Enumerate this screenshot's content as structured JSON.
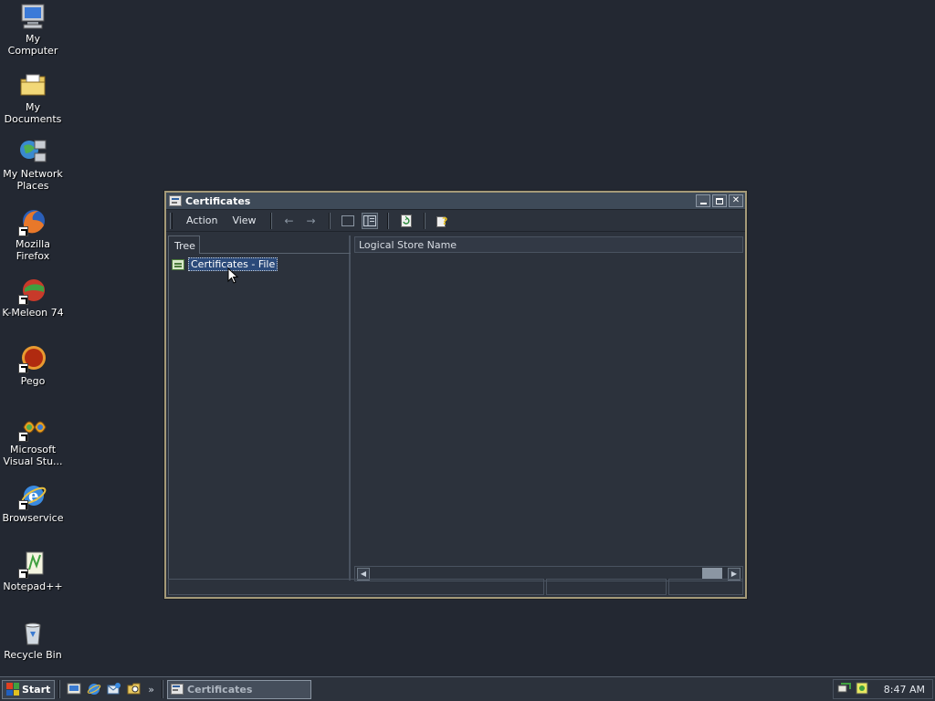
{
  "desktop": {
    "icons": [
      {
        "label": "My Computer"
      },
      {
        "label": "My Documents"
      },
      {
        "label": "My Network Places"
      },
      {
        "label": "Mozilla Firefox"
      },
      {
        "label": "K-Meleon 74"
      },
      {
        "label": "Pego"
      },
      {
        "label": "Microsoft Visual Stu..."
      },
      {
        "label": "Browservice"
      },
      {
        "label": "Notepad++"
      },
      {
        "label": "Recycle Bin"
      }
    ]
  },
  "window": {
    "title": "Certificates",
    "menu": {
      "action": "Action",
      "view": "View"
    },
    "tree": {
      "tab_label": "Tree",
      "node_label": "Certificates - File"
    },
    "list": {
      "column_header": "Logical Store Name"
    }
  },
  "taskbar": {
    "start_label": "Start",
    "task_label": "Certificates",
    "clock": "8:47 AM"
  },
  "colors": {
    "desktop_bg": "#232832",
    "window_border": "#a59a78",
    "selection": "#2b4a7a"
  }
}
